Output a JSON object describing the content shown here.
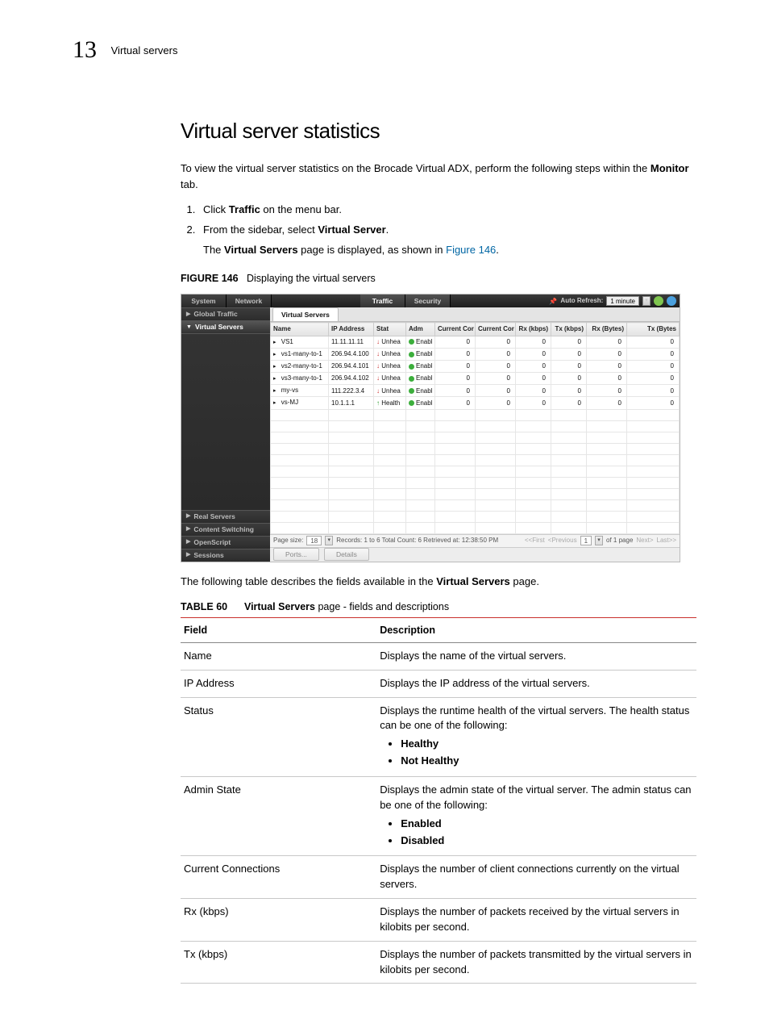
{
  "header": {
    "chapter_num": "13",
    "breadcrumb": "Virtual servers"
  },
  "section": {
    "title": "Virtual server statistics",
    "intro_pre": "To view the virtual server statistics on the Brocade Virtual ADX, perform the following steps within the ",
    "intro_bold": "Monitor",
    "intro_post": " tab.",
    "step1_pre": "Click ",
    "step1_bold": "Traffic",
    "step1_post": " on the menu bar.",
    "step2_pre": "From the sidebar, select ",
    "step2_bold": "Virtual Server",
    "step2_post": ".",
    "step2_sub_pre": "The ",
    "step2_sub_bold": "Virtual Servers",
    "step2_sub_mid": " page is displayed, as shown in ",
    "step2_sub_link": "Figure 146",
    "step2_sub_post": ".",
    "fig_label": "FIGURE 146",
    "fig_title": "Displaying the virtual servers",
    "after_fig_pre": "The following table describes the fields available in the ",
    "after_fig_bold": "Virtual Servers",
    "after_fig_post": " page.",
    "tbl_label": "TABLE 60",
    "tbl_title_b": "Virtual Servers",
    "tbl_title_rest": " page - fields and descriptions"
  },
  "screenshot": {
    "top_tabs": {
      "system": "System",
      "network": "Network",
      "traffic": "Traffic",
      "security": "Security"
    },
    "auto_refresh_label": "Auto Refresh:",
    "auto_refresh_value": "1 minute",
    "sidebar": {
      "global_traffic": "Global Traffic",
      "virtual_servers": "Virtual Servers",
      "real_servers": "Real Servers",
      "content_switching": "Content Switching",
      "openscript": "OpenScript",
      "sessions": "Sessions"
    },
    "page_tab": "Virtual Servers",
    "columns": {
      "name": "Name",
      "ip": "IP Address",
      "status": "Stat",
      "admin": "Adm",
      "curcon1": "Current Cor",
      "curcon2": "Current Cor",
      "rx": "Rx (kbps)",
      "tx": "Tx (kbps)",
      "rxb": "Rx (Bytes)",
      "txb": "Tx (Bytes"
    },
    "rows": [
      {
        "name": "VS1",
        "ip": "11.11.11.11",
        "stat": "Unhea",
        "stat_ok": false,
        "adm": "Enabl"
      },
      {
        "name": "vs1-many-to-1",
        "ip": "206.94.4.100",
        "stat": "Unhea",
        "stat_ok": false,
        "adm": "Enabl"
      },
      {
        "name": "vs2-many-to-1",
        "ip": "206.94.4.101",
        "stat": "Unhea",
        "stat_ok": false,
        "adm": "Enabl"
      },
      {
        "name": "vs3-many-to-1",
        "ip": "206.94.4.102",
        "stat": "Unhea",
        "stat_ok": false,
        "adm": "Enabl"
      },
      {
        "name": "my-vs",
        "ip": "111.222.3.4",
        "stat": "Unhea",
        "stat_ok": false,
        "adm": "Enabl"
      },
      {
        "name": "vs-MJ",
        "ip": "10.1.1.1",
        "stat": "Health",
        "stat_ok": true,
        "adm": "Enabl"
      }
    ],
    "zero": "0",
    "pager": {
      "page_size_label": "Page size:",
      "page_size_value": "18",
      "records": "Records: 1 to 6  Total Count: 6  Retrieved at: 12:38:50 PM",
      "first": "<<First",
      "prev": "<Previous",
      "page_value": "1",
      "of_pages": "of 1 page",
      "next": "Next>",
      "last": "Last>>"
    },
    "buttons": {
      "ports": "Ports...",
      "details": "Details"
    }
  },
  "table60": {
    "col_field": "Field",
    "col_desc": "Description",
    "rows": [
      {
        "field": "Name",
        "desc": "Displays the name of the virtual servers."
      },
      {
        "field": "IP Address",
        "desc": "Displays the IP address of the virtual servers."
      },
      {
        "field": "Status",
        "desc": "Displays the runtime health of the virtual servers. The health status can be one of the following:",
        "bullets": [
          "Healthy",
          "Not Healthy"
        ]
      },
      {
        "field": "Admin State",
        "desc": "Displays the admin state of the virtual server. The admin status can be one of the following:",
        "bullets": [
          "Enabled",
          "Disabled"
        ]
      },
      {
        "field": "Current Connections",
        "desc": "Displays the number of client connections currently on the virtual servers."
      },
      {
        "field": "Rx (kbps)",
        "desc": "Displays the number of packets received by the virtual servers in kilobits per second."
      },
      {
        "field": "Tx (kbps)",
        "desc": "Displays the number of packets transmitted by the virtual servers in kilobits per second."
      }
    ]
  }
}
